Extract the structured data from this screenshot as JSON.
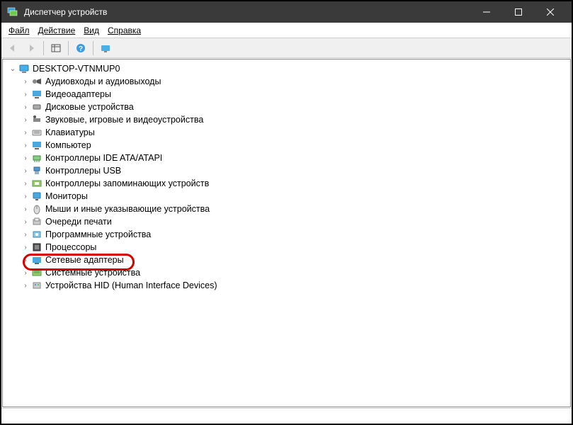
{
  "window": {
    "title": "Диспетчер устройств"
  },
  "menu": {
    "file": "Файл",
    "action": "Действие",
    "view": "Вид",
    "help": "Справка"
  },
  "tree": {
    "root": "DESKTOP-VTNMUP0",
    "items": [
      "Аудиовходы и аудиовыходы",
      "Видеоадаптеры",
      "Дисковые устройства",
      "Звуковые, игровые и видеоустройства",
      "Клавиатуры",
      "Компьютер",
      "Контроллеры IDE ATA/ATAPI",
      "Контроллеры USB",
      "Контроллеры запоминающих устройств",
      "Мониторы",
      "Мыши и иные указывающие устройства",
      "Очереди печати",
      "Программные устройства",
      "Процессоры",
      "Сетевые адаптеры",
      "Системные устройства",
      "Устройства HID (Human Interface Devices)"
    ],
    "highlighted_index": 14
  }
}
